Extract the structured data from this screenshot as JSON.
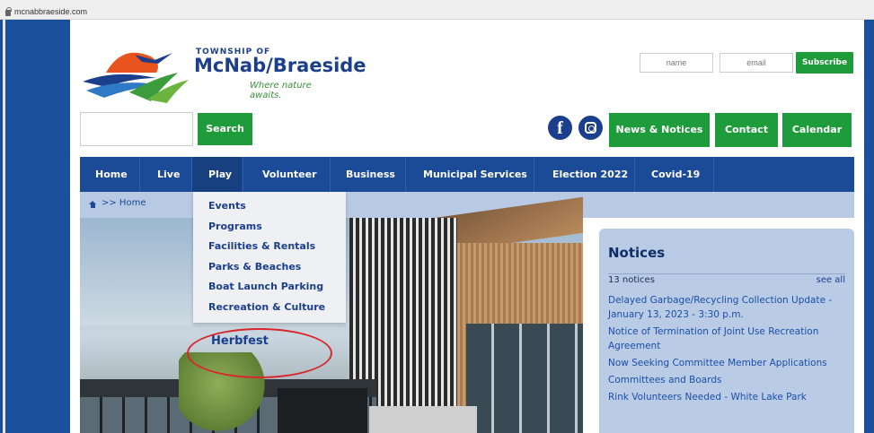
{
  "browser": {
    "url": "mcnabbraeside.com"
  },
  "logo": {
    "line1": "TOWNSHIP OF",
    "line2": "McNab/Braeside",
    "tagline": "Where nature awaits."
  },
  "subscribe": {
    "name_placeholder": "name",
    "email_placeholder": "email",
    "button": "Subscribe"
  },
  "search": {
    "value": "",
    "button": "Search"
  },
  "social": {
    "facebook_icon": "f"
  },
  "header_buttons": {
    "news": "News & Notices",
    "contact": "Contact",
    "calendar": "Calendar"
  },
  "nav": {
    "items": [
      {
        "label": "Home"
      },
      {
        "label": "Live"
      },
      {
        "label": "Play"
      },
      {
        "label": "Volunteer"
      },
      {
        "label": "Business"
      },
      {
        "label": "Municipal Services"
      },
      {
        "label": "Election 2022"
      },
      {
        "label": "Covid-19"
      }
    ],
    "active": "Play"
  },
  "breadcrumb": {
    "text": ">> Home"
  },
  "play_menu": {
    "items": [
      "Events",
      "Programs",
      "Facilities & Rentals",
      "Parks & Beaches",
      "Boat Launch Parking",
      "Recreation & Culture"
    ]
  },
  "annotation": {
    "label": "Herbfest",
    "color": "#d9262c"
  },
  "notices": {
    "title": "Notices",
    "count": "13 notices",
    "see_all": "see all",
    "items": [
      "Delayed Garbage/Recycling Collection Update - January 13, 2023 - 3:30 p.m.",
      "Notice of Termination of Joint Use Recreation Agreement",
      "Now Seeking Committee Member Applications",
      "Committees and Boards",
      "Rink Volunteers Needed - White Lake Park"
    ]
  },
  "colors": {
    "nav_blue": "#1b4a96",
    "button_green": "#1e9b3a",
    "brand_blue": "#1b3f8c",
    "notices_bg": "#b9cbe5"
  }
}
